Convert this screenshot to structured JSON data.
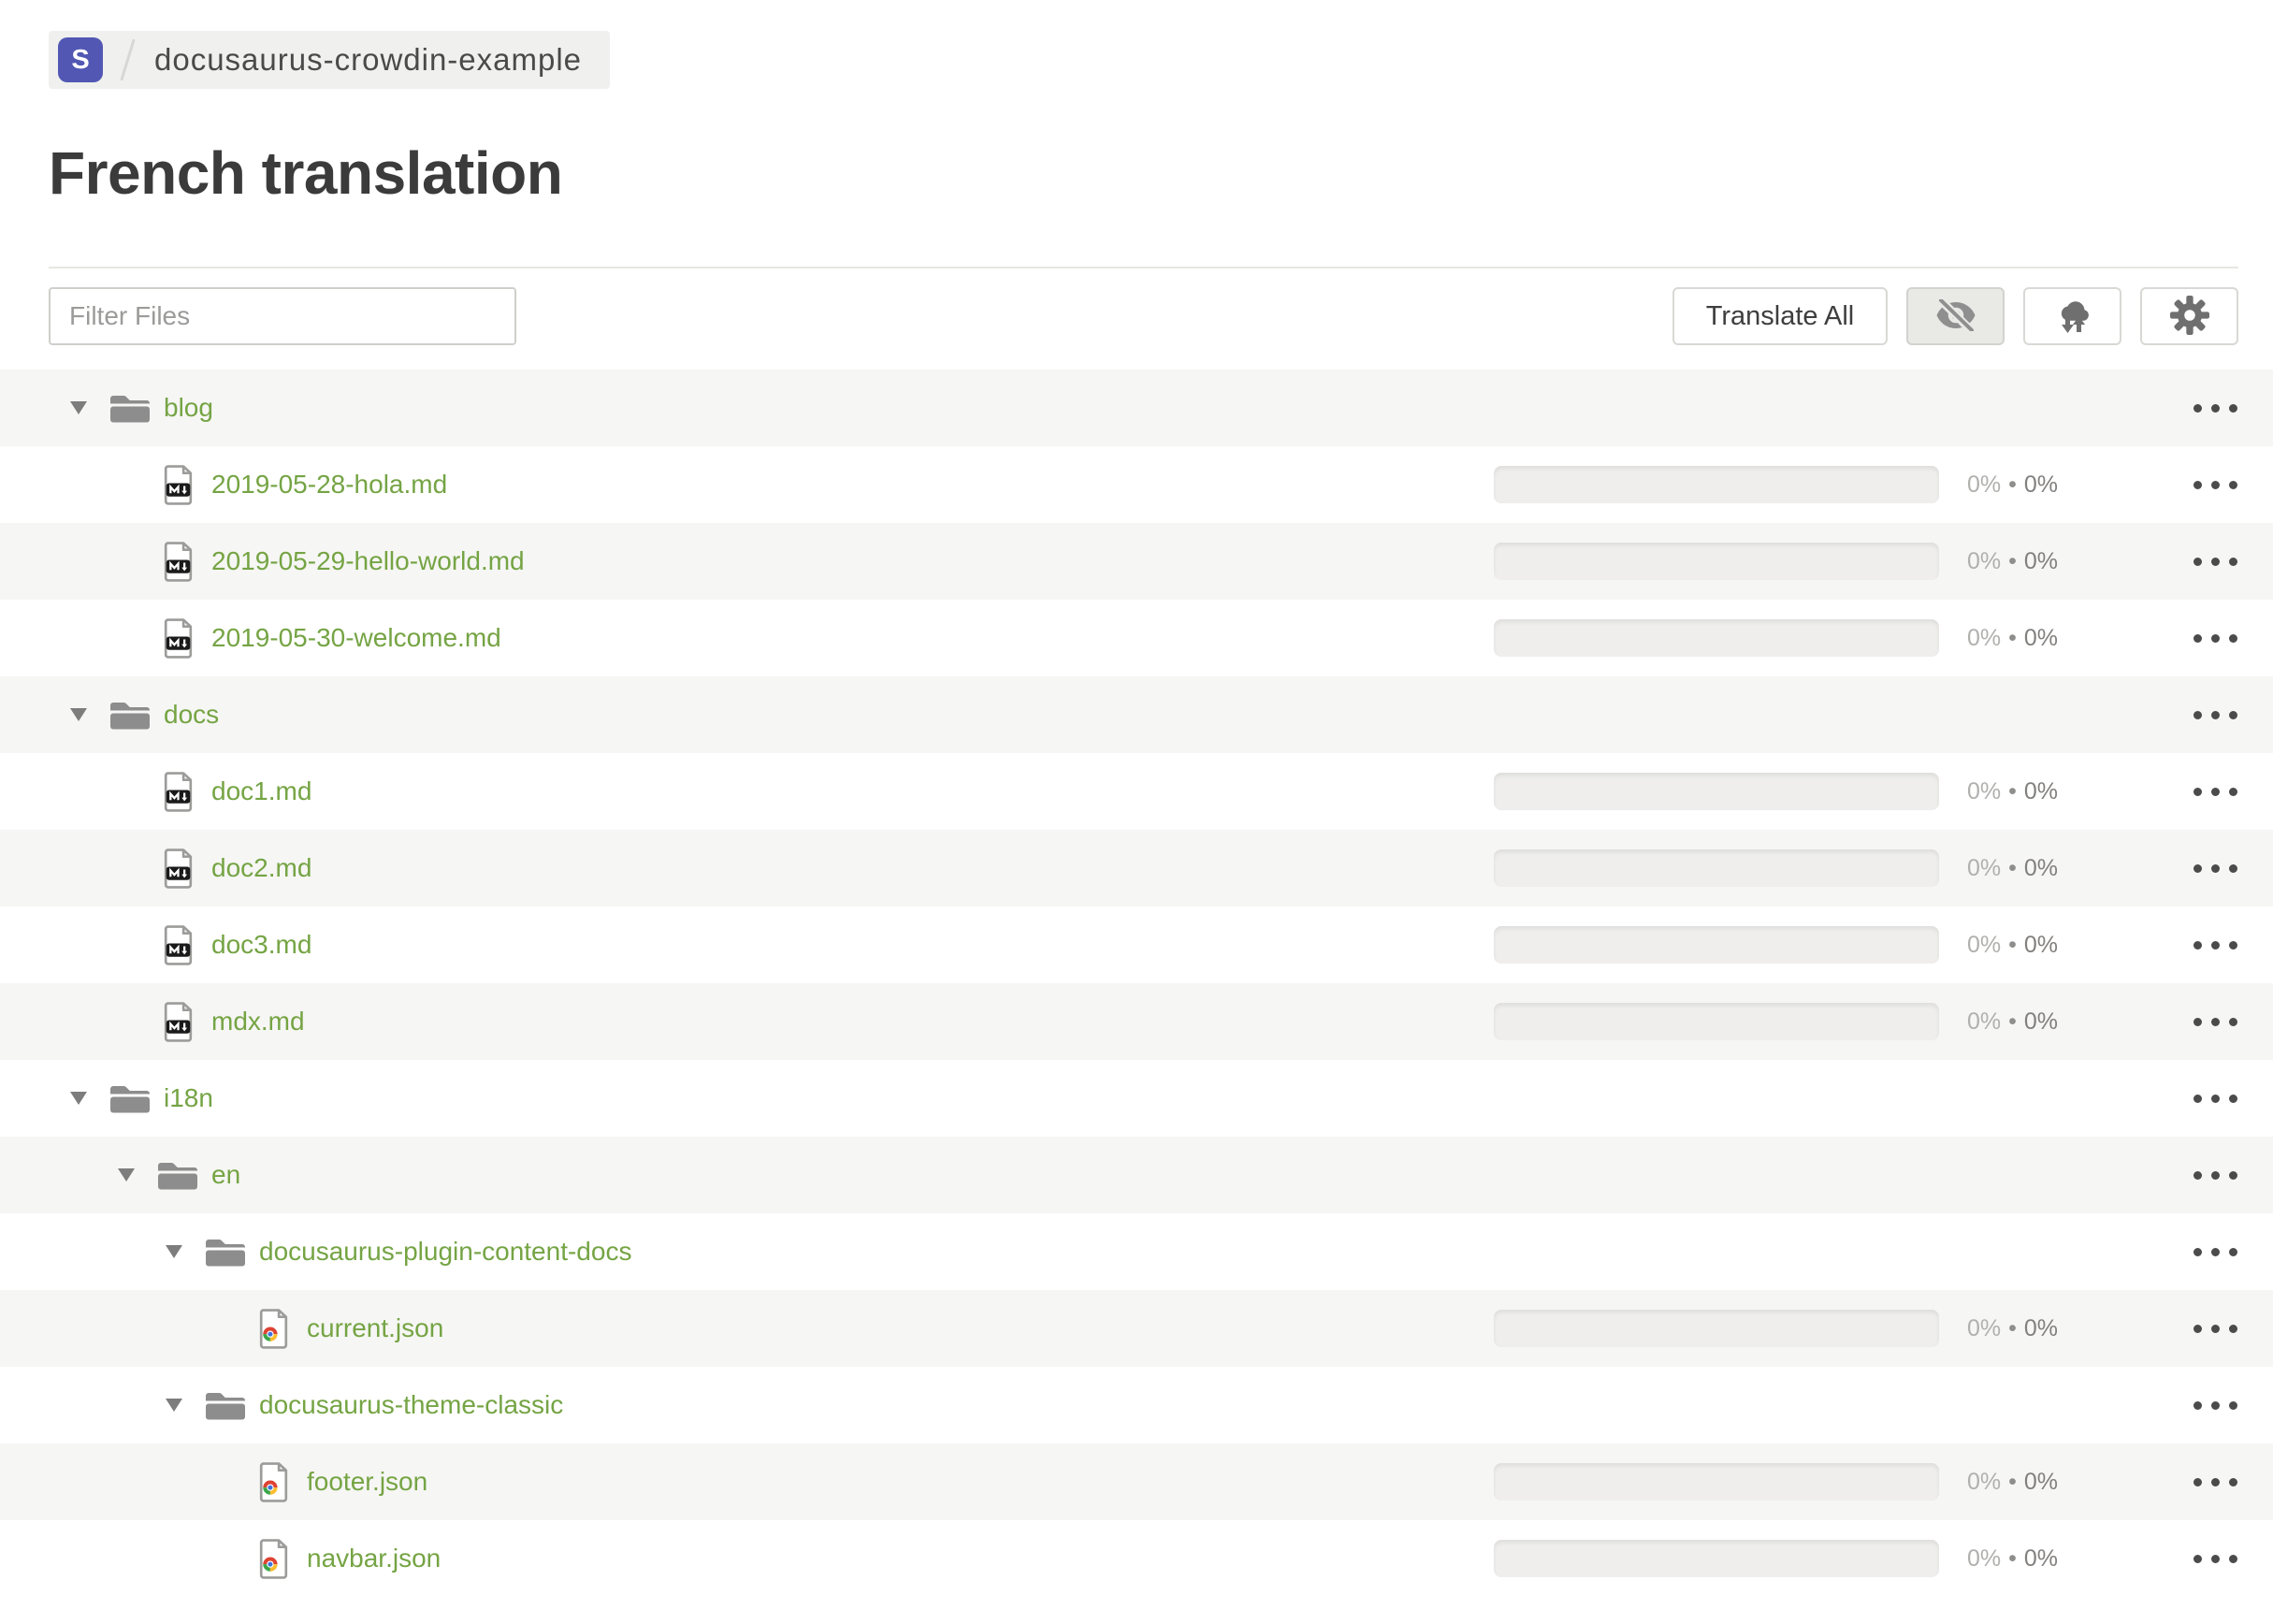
{
  "breadcrumb": {
    "badge": "S",
    "project": "docusaurus-crowdin-example"
  },
  "page": {
    "title": "French translation"
  },
  "toolbar": {
    "filter_placeholder": "Filter Files",
    "translate_all": "Translate All",
    "icon_buttons": [
      "eye-off-icon",
      "cloud-sync-icon",
      "gear-icon"
    ]
  },
  "icons": {
    "breadcrumb_separator": "slash-divider",
    "folder": "folder-icon",
    "expand": "chevron-down-icon",
    "markdown_file": "markdown-file-icon",
    "json_file": "chrome-json-file-icon",
    "row_menu": "ellipsis-icon"
  },
  "colors": {
    "accent_green": "#75a444",
    "badge_indigo": "#5157b3",
    "row_stripe": "#f6f6f4",
    "progress_track": "#efeeec"
  },
  "tree": {
    "separator": "•",
    "rows": [
      {
        "type": "folder",
        "depth": 0,
        "name": "blog",
        "expanded": true
      },
      {
        "type": "file",
        "format": "md",
        "depth": 1,
        "name": "2019-05-28-hola.md",
        "translated": "0%",
        "approved": "0%"
      },
      {
        "type": "file",
        "format": "md",
        "depth": 1,
        "name": "2019-05-29-hello-world.md",
        "translated": "0%",
        "approved": "0%"
      },
      {
        "type": "file",
        "format": "md",
        "depth": 1,
        "name": "2019-05-30-welcome.md",
        "translated": "0%",
        "approved": "0%"
      },
      {
        "type": "folder",
        "depth": 0,
        "name": "docs",
        "expanded": true
      },
      {
        "type": "file",
        "format": "md",
        "depth": 1,
        "name": "doc1.md",
        "translated": "0%",
        "approved": "0%"
      },
      {
        "type": "file",
        "format": "md",
        "depth": 1,
        "name": "doc2.md",
        "translated": "0%",
        "approved": "0%"
      },
      {
        "type": "file",
        "format": "md",
        "depth": 1,
        "name": "doc3.md",
        "translated": "0%",
        "approved": "0%"
      },
      {
        "type": "file",
        "format": "md",
        "depth": 1,
        "name": "mdx.md",
        "translated": "0%",
        "approved": "0%"
      },
      {
        "type": "folder",
        "depth": 0,
        "name": "i18n",
        "expanded": true
      },
      {
        "type": "folder",
        "depth": 1,
        "name": "en",
        "expanded": true
      },
      {
        "type": "folder",
        "depth": 2,
        "name": "docusaurus-plugin-content-docs",
        "expanded": true
      },
      {
        "type": "file",
        "format": "json",
        "depth": 3,
        "name": "current.json",
        "translated": "0%",
        "approved": "0%"
      },
      {
        "type": "folder",
        "depth": 2,
        "name": "docusaurus-theme-classic",
        "expanded": true
      },
      {
        "type": "file",
        "format": "json",
        "depth": 3,
        "name": "footer.json",
        "translated": "0%",
        "approved": "0%"
      },
      {
        "type": "file",
        "format": "json",
        "depth": 3,
        "name": "navbar.json",
        "translated": "0%",
        "approved": "0%"
      }
    ]
  }
}
